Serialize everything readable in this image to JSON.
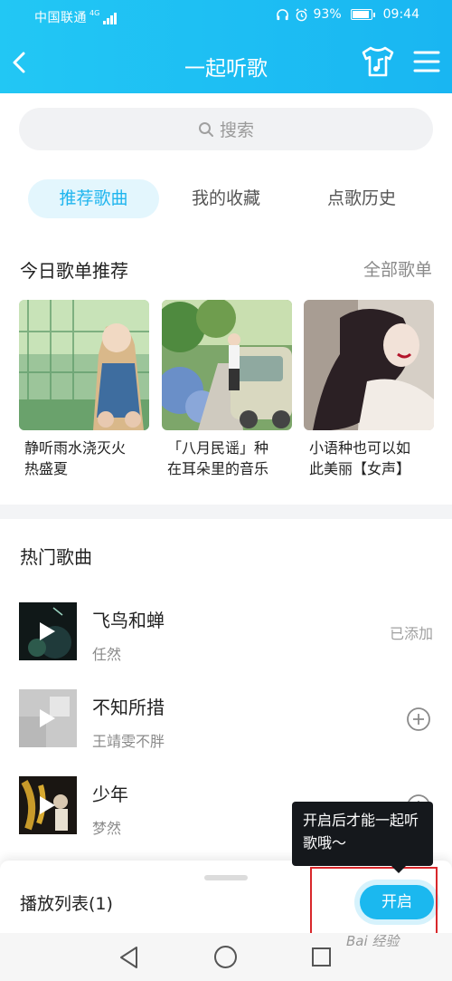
{
  "status_bar": {
    "carrier": "中国联通",
    "network": "4G",
    "battery": "93%",
    "time": "09:44",
    "battery_level": 0.93
  },
  "header": {
    "title": "一起听歌"
  },
  "search": {
    "placeholder": "搜索"
  },
  "tabs": [
    {
      "label": "推荐歌曲",
      "active": true
    },
    {
      "label": "我的收藏",
      "active": false
    },
    {
      "label": "点歌历史",
      "active": false
    }
  ],
  "playlists": {
    "title": "今日歌单推荐",
    "see_all": "全部歌单",
    "items": [
      {
        "line1": "静听雨水浇灭火",
        "line2": "热盛夏"
      },
      {
        "line1": "「八月民谣」种",
        "line2": "在耳朵里的音乐"
      },
      {
        "line1": "小语种也可以如",
        "line2": "此美丽【女声】"
      }
    ]
  },
  "hot_songs": {
    "title": "热门歌曲",
    "items": [
      {
        "title": "飞鸟和蝉",
        "artist": "任然",
        "status": "已添加"
      },
      {
        "title": "不知所措",
        "artist": "王靖雯不胖",
        "status": ""
      },
      {
        "title": "少年",
        "artist": "梦然",
        "status": ""
      }
    ]
  },
  "bottom": {
    "playlist_label": "播放列表(1)",
    "open_button": "开启",
    "tooltip": "开启后才能一起听歌哦～"
  },
  "watermark": "Bai 经验",
  "colors": {
    "accent": "#1bb8ef",
    "header_start": "#22c7f4",
    "tab_active_bg": "#e3f6fd",
    "highlight_box": "#d9272b"
  }
}
